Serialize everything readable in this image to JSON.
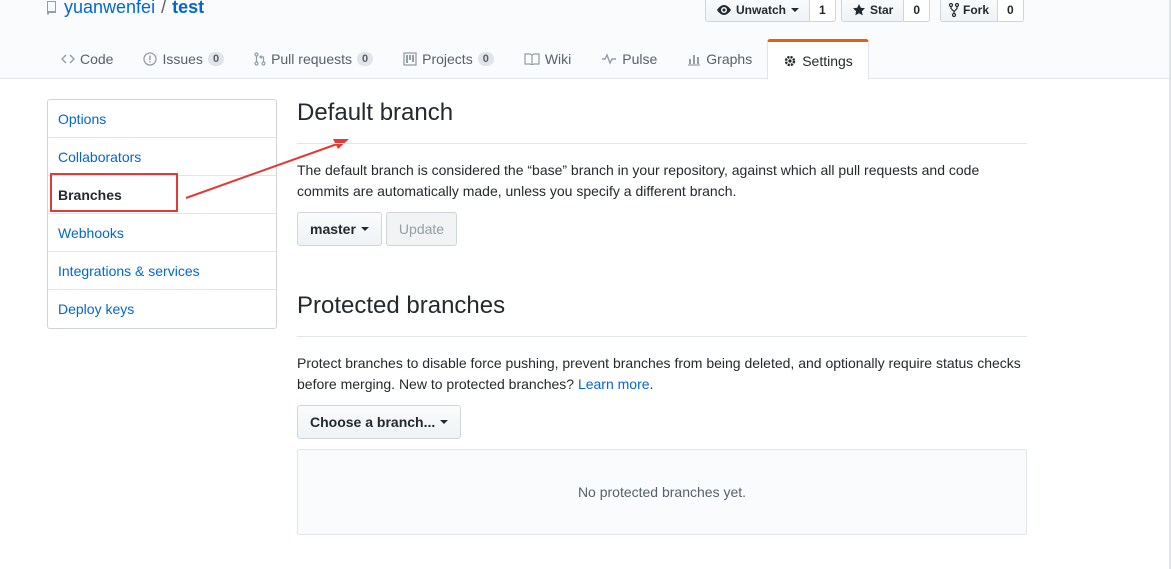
{
  "repo": {
    "owner": "yuanwenfei",
    "separator": "/",
    "name": "test"
  },
  "actions": [
    {
      "label": "Unwatch",
      "count": "1",
      "icon": "eye-icon"
    },
    {
      "label": "Star",
      "count": "0",
      "icon": "star-icon"
    },
    {
      "label": "Fork",
      "count": "0",
      "icon": "fork-icon"
    }
  ],
  "tabs": [
    {
      "label": "Code",
      "counter": null
    },
    {
      "label": "Issues",
      "counter": "0"
    },
    {
      "label": "Pull requests",
      "counter": "0"
    },
    {
      "label": "Projects",
      "counter": "0"
    },
    {
      "label": "Wiki",
      "counter": null
    },
    {
      "label": "Pulse",
      "counter": null
    },
    {
      "label": "Graphs",
      "counter": null
    },
    {
      "label": "Settings",
      "counter": null
    }
  ],
  "menu": [
    "Options",
    "Collaborators",
    "Branches",
    "Webhooks",
    "Integrations & services",
    "Deploy keys"
  ],
  "default_branch": {
    "heading": "Default branch",
    "description": "The default branch is considered the “base” branch in your repository, against which all pull requests and code commits are automatically made, unless you specify a different branch.",
    "branch_button": "master",
    "update_button": "Update"
  },
  "protected_branches": {
    "heading": "Protected branches",
    "description": "Protect branches to disable force pushing, prevent branches from being deleted, and optionally require status checks before merging. New to protected branches?",
    "learn_more": "Learn more",
    "period": ".",
    "choose_button": "Choose a branch...",
    "empty_state": "No protected branches yet."
  },
  "colors": {
    "link": "#0366d6",
    "annotation": "#e53935",
    "tab_accent": "#e36209"
  }
}
